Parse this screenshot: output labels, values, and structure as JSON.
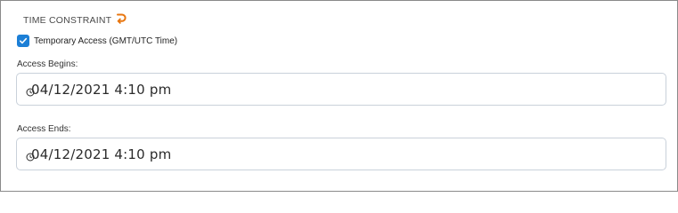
{
  "section": {
    "title": "TIME CONSTRAINT"
  },
  "temporary_access": {
    "checked": true,
    "label": "Temporary Access (GMT/UTC Time)"
  },
  "access_begins": {
    "label": "Access Begins:",
    "value": "04/12/2021 4:10 pm"
  },
  "access_ends": {
    "label": "Access Ends:",
    "value": "04/12/2021 4:10 pm"
  },
  "colors": {
    "accent": "#1c7fd6",
    "undo_icon": "#e8760f",
    "border": "#c9d1da"
  },
  "icons": {
    "reset": "undo-icon",
    "checkbox": "checkmark-icon",
    "time": "clock-icon"
  }
}
